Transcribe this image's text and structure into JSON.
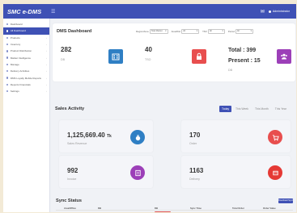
{
  "app": {
    "brand": "SMC e-DMS",
    "user": "Administrator"
  },
  "sidebar": {
    "items": [
      {
        "label": "Dashboard",
        "active": false
      },
      {
        "label": "All Dashboard",
        "active": true
      },
      {
        "label": "Products",
        "active": false
      },
      {
        "label": "Inventory",
        "active": false
      },
      {
        "label": "Product Distribution",
        "active": false
      },
      {
        "label": "Market Intelligence",
        "active": false
      },
      {
        "label": "Manage",
        "active": false
      },
      {
        "label": "Delivery Activities",
        "active": false
      },
      {
        "label": "DMS Loyalty Mobile Reports",
        "active": false
      },
      {
        "label": "Reports Financials",
        "active": false
      },
      {
        "label": "Settings",
        "active": false
      }
    ]
  },
  "dashboard": {
    "title": "DMS Dashboard",
    "filters": [
      {
        "label": "Region/Area",
        "value": "Total Market"
      },
      {
        "label": "Area/Dist",
        "value": "All"
      },
      {
        "label": "TSO",
        "value": "All"
      },
      {
        "label": "Period",
        "value": "All"
      }
    ],
    "stats": [
      {
        "value": "282",
        "label": "DB"
      },
      {
        "value": "40",
        "label": "TSO"
      }
    ],
    "total_line": "Total : 399",
    "present_line": "Present : 15",
    "present_label": "DB"
  },
  "sales": {
    "title": "Sales Activity",
    "tabs": [
      {
        "label": "Today",
        "active": true
      },
      {
        "label": "This Week",
        "active": false
      },
      {
        "label": "This Month",
        "active": false
      },
      {
        "label": "This Year",
        "active": false
      }
    ],
    "cards": [
      {
        "value": "1,125,669.40",
        "unit": "Tk",
        "label": "Sales Revenue",
        "color": "#2f7fc4"
      },
      {
        "value": "170",
        "label": "Order",
        "color": "#e84e4e"
      },
      {
        "value": "992",
        "label": "Invoice",
        "color": "#9c3fb8"
      },
      {
        "value": "1163",
        "label": "Delivery",
        "color": "#e53935"
      }
    ]
  },
  "sync": {
    "title": "Sync Status",
    "button": "Download Sync",
    "columns": [
      "Area/Office",
      "DB",
      "DB",
      "Sync Time",
      "Total Order",
      "Order Value"
    ],
    "rows": [
      [
        "",
        "",
        "",
        "",
        "",
        ""
      ]
    ]
  },
  "colors": {
    "primary": "#3f51b5",
    "accent_blue": "#2f7fc4",
    "accent_red": "#e84e4e",
    "accent_purple": "#9c3fb8"
  }
}
